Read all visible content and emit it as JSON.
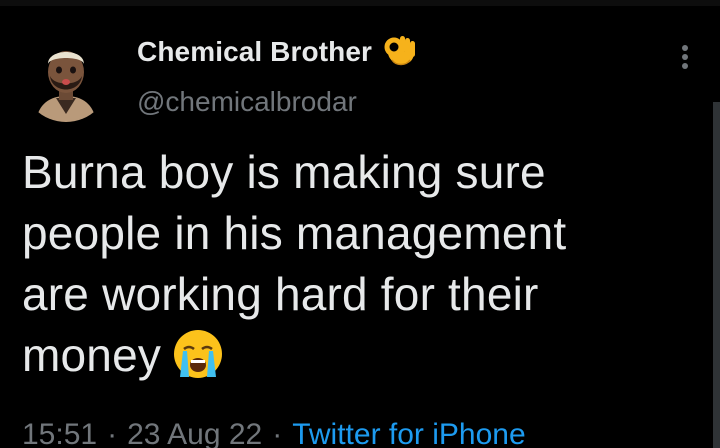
{
  "tweet": {
    "author": {
      "display_name": "Chemical Brother",
      "name_emoji": "ok-hand-emoji",
      "handle": "@chemicalbrodar",
      "avatar": "memoji-avatar"
    },
    "text_lines": [
      "Burna boy is making sure",
      "people in his management",
      "are working hard for their",
      "money"
    ],
    "text_emoji": "loudly-crying-face-emoji",
    "time": "15:51",
    "separator": "·",
    "date": "23 Aug 22",
    "source": "Twitter for iPhone"
  },
  "colors": {
    "background": "#000000",
    "text": "#e7e9ea",
    "secondary": "#71767b",
    "link": "#1d9bf0"
  }
}
